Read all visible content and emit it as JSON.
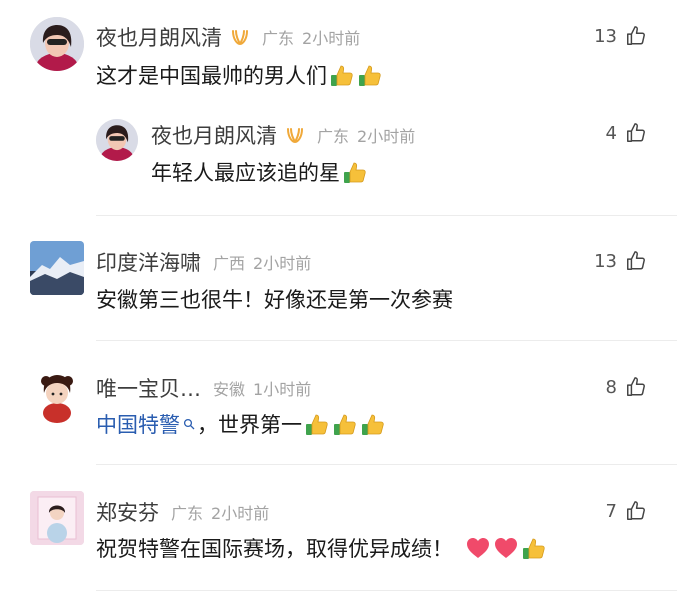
{
  "comments": [
    {
      "name": "夜也月朗风清",
      "region": "广东",
      "time": "2小时前",
      "text": "这才是中国最帅的男人们",
      "likes": "13",
      "thumb_emojis": 2,
      "reply": {
        "name": "夜也月朗风清",
        "region": "广东",
        "time": "2小时前",
        "text": "年轻人最应该追的星",
        "likes": "4",
        "thumb_emojis": 1
      }
    },
    {
      "name": "印度洋海啸",
      "region": "广西",
      "time": "2小时前",
      "text": "安徽第三也很牛！好像还是第一次参赛",
      "likes": "13"
    },
    {
      "name": "唯一宝贝…",
      "region": "安徽",
      "time": "1小时前",
      "link_text": "中国特警",
      "text": "，世界第一",
      "likes": "8",
      "thumb_emojis": 3
    },
    {
      "name": "郑安芬",
      "region": "广东",
      "time": "2小时前",
      "text": "祝贺特警在国际赛场，取得优异成绩！",
      "likes": "7",
      "heart_emojis": 2,
      "thumb_emojis": 1
    }
  ],
  "colors": {
    "name": "#3d3d3d",
    "meta": "#a3a3a3",
    "link": "#2a5db0",
    "badge": "#f0a93a"
  },
  "icons": [
    "thumbs-up-outline-icon",
    "thumbs-up-emoji",
    "heart-emoji",
    "vip-badge-icon",
    "search-icon"
  ]
}
